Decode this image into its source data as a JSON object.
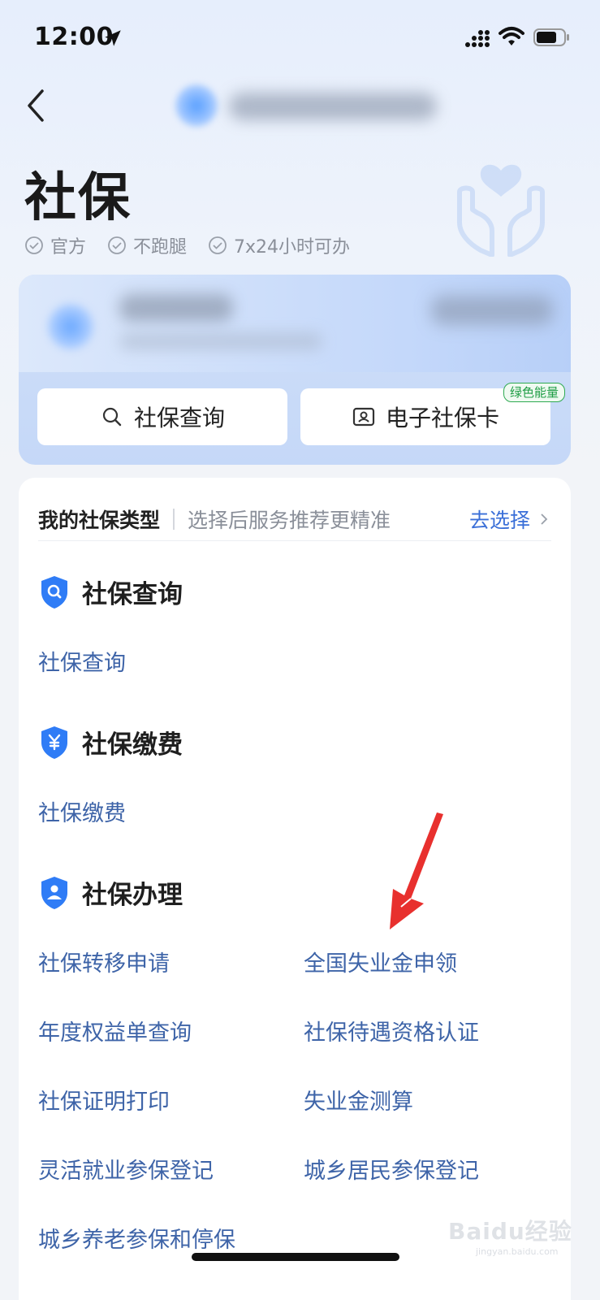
{
  "status_bar": {
    "time": "12:00"
  },
  "header": {
    "title": "社保",
    "back_icon": "chevron-left-icon"
  },
  "badges": [
    "官方",
    "不跑腿",
    "7x24小时可办"
  ],
  "quick_actions": {
    "query_label": "社保查询",
    "card_label": "电子社保卡",
    "energy_tag": "绿色能量"
  },
  "insurance_type": {
    "label": "我的社保类型",
    "hint": "选择后服务推荐更精准",
    "action": "去选择"
  },
  "sections": {
    "query": {
      "title": "社保查询",
      "icon": "shield-search-icon",
      "links": [
        "社保查询"
      ]
    },
    "payment": {
      "title": "社保缴费",
      "icon": "shield-yen-icon",
      "links": [
        "社保缴费"
      ]
    },
    "handling": {
      "title": "社保办理",
      "icon": "shield-user-icon",
      "links": [
        "社保转移申请",
        "全国失业金申领",
        "年度权益单查询",
        "社保待遇资格认证",
        "社保证明打印",
        "失业金测算",
        "灵活就业参保登记",
        "城乡居民参保登记",
        "城乡养老参保和停保"
      ]
    }
  },
  "watermark": {
    "main": "Baidu经验",
    "sub": "jingyan.baidu.com"
  },
  "colors": {
    "accent": "#3a6fd8",
    "link": "#3e64a8",
    "shield": "#2f7cf6",
    "arrow": "#e8302e",
    "energy": "#2faa52"
  }
}
